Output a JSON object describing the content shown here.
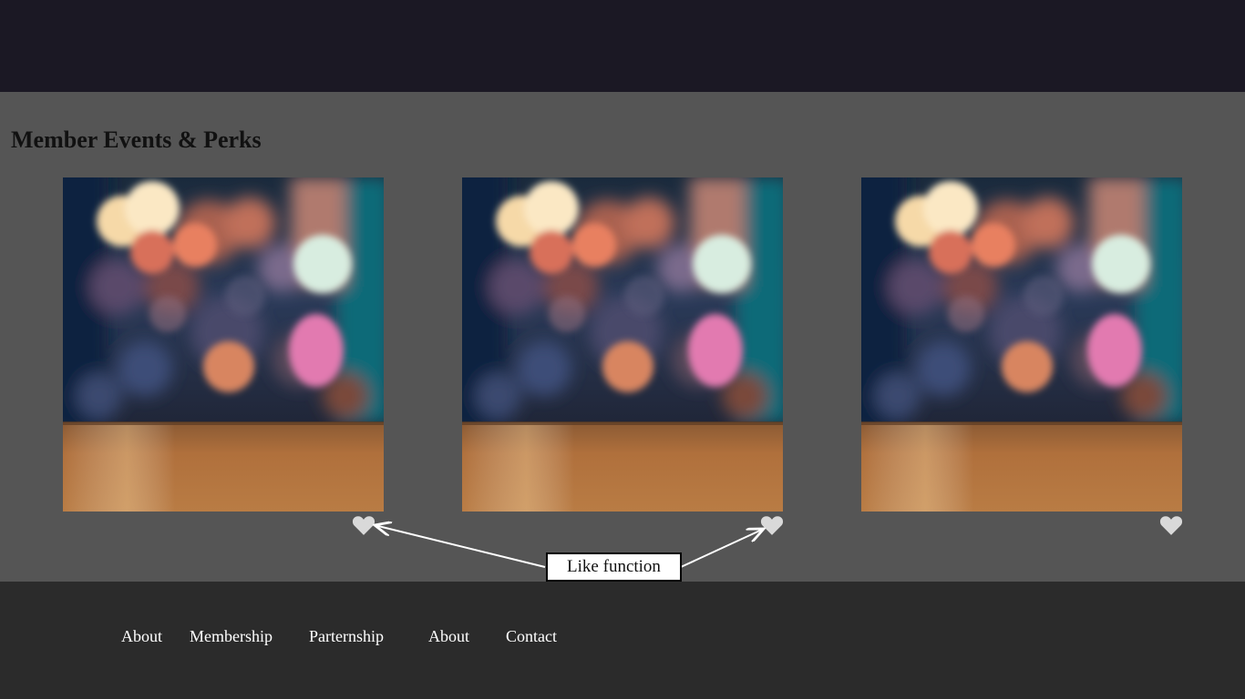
{
  "main": {
    "title": "Member Events & Perks",
    "cards": [
      {
        "image": "blurred-bokeh-bar-counter-photo",
        "like_icon": "heart-icon"
      },
      {
        "image": "blurred-bokeh-bar-counter-photo",
        "like_icon": "heart-icon"
      },
      {
        "image": "blurred-bokeh-bar-counter-photo",
        "like_icon": "heart-icon"
      }
    ]
  },
  "annotation": {
    "label": "Like function"
  },
  "footer": {
    "links": [
      "About",
      "Membership",
      "Parternship",
      "About",
      "Contact"
    ]
  },
  "colors": {
    "header_bg": "#1b1824",
    "main_bg": "#555555",
    "footer_bg": "#2b2b2b",
    "heart": "#d9d9d9"
  }
}
